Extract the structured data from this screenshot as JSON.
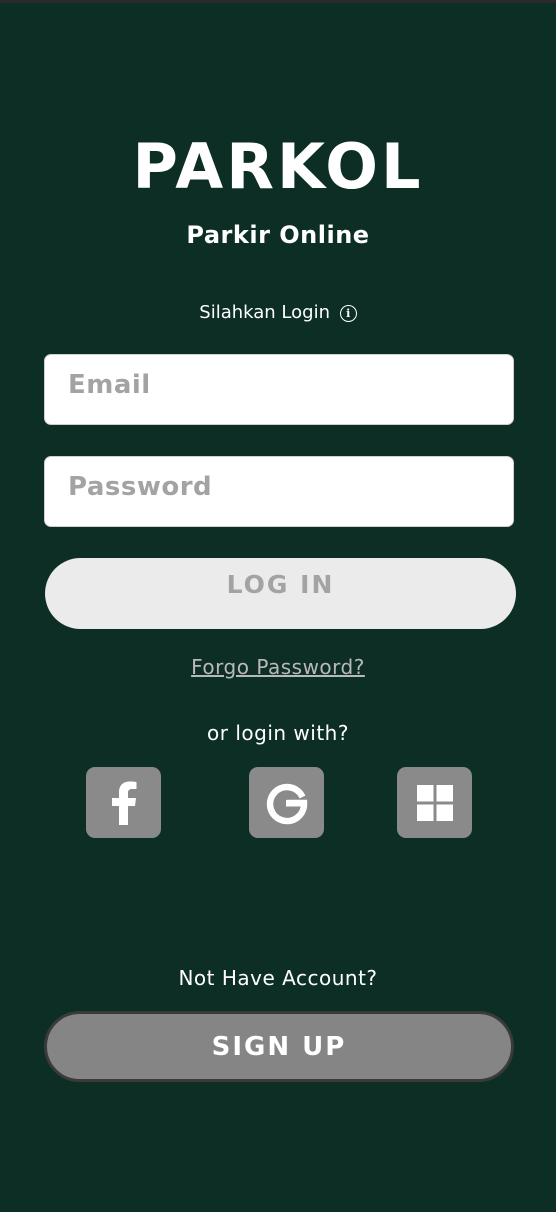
{
  "app": {
    "title": "PARKOL",
    "subtitle": "Parkir Online"
  },
  "login": {
    "prompt": "Silahkan Login",
    "info_icon": "info-icon",
    "email_placeholder": "Email",
    "password_placeholder": "Password",
    "login_label": "LOG IN",
    "forgot_label": "Forgo Password?",
    "or_login_label": "or login with?"
  },
  "social": {
    "facebook_icon": "facebook-icon",
    "google_icon": "google-icon",
    "microsoft_icon": "microsoft-icon"
  },
  "signup": {
    "prompt": "Not Have Account?",
    "button_label": "SIGN UP"
  },
  "colors": {
    "background": "#0d2e24",
    "field_background": "#ffffff",
    "login_button": "#ebebeb",
    "social_button": "#8a8a8a",
    "signup_button": "#858585"
  }
}
